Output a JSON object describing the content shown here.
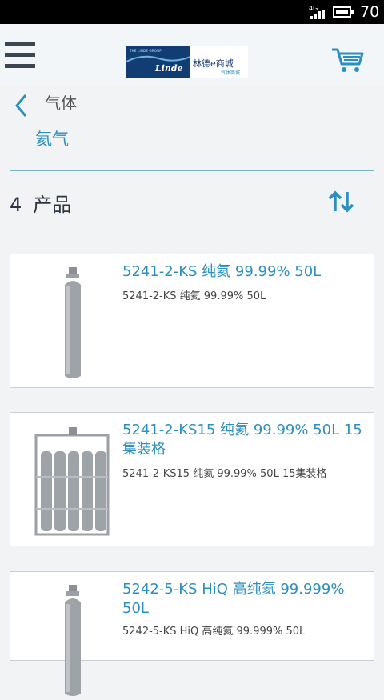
{
  "status_bar": {
    "network": "4G",
    "battery_level": "70"
  },
  "header": {
    "logo": {
      "group_text": "THE LINDE GROUP",
      "brand": "Linde",
      "mall_name": "林德e商城",
      "mall_sub": "气体商城"
    }
  },
  "breadcrumb": {
    "parent": "气体",
    "current": "氦气"
  },
  "results": {
    "count": "4",
    "label": "产品"
  },
  "products": [
    {
      "title": "5241-2-KS 纯氦 99.99% 50L",
      "subtitle": "5241-2-KS 纯氦 99.99% 50L"
    },
    {
      "title": "5241-2-KS15 纯氦 99.99% 50L 15集装格",
      "subtitle": "5241-2-KS15 纯氦 99.99% 50L 15集装格"
    },
    {
      "title": "5242-5-KS HiQ 高纯氦 99.999% 50L",
      "subtitle": "5242-5-KS HiQ 高纯氦 99.999% 50L"
    }
  ],
  "colors": {
    "accent": "#2b8fbf",
    "divider": "#7ab2c9",
    "brand_blue": "#123d73"
  },
  "icons": {
    "menu": "hamburger-menu-icon",
    "cart": "shopping-cart-icon",
    "back": "chevron-left-icon",
    "sort": "sort-arrows-icon"
  }
}
